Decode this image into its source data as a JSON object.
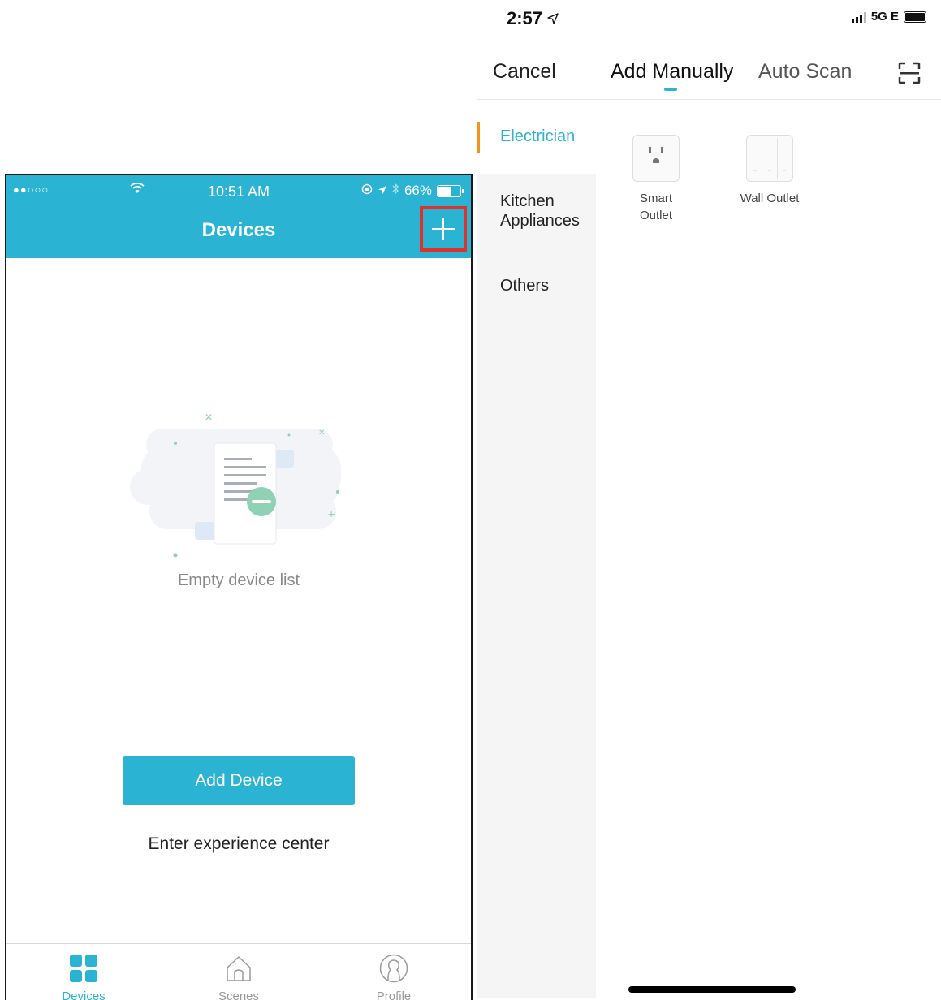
{
  "left_phone": {
    "status": {
      "signal": "●●○○○",
      "time": "10:51 AM",
      "battery_pct": "66%",
      "battery_level": 0.66
    },
    "header": {
      "title": "Devices"
    },
    "empty": {
      "message": "Empty device list"
    },
    "add_device_label": "Add Device",
    "experience_label": "Enter experience center",
    "tabs": [
      {
        "label": "Devices",
        "icon": "grid-icon",
        "active": true
      },
      {
        "label": "Scenes",
        "icon": "home-icon",
        "active": false
      },
      {
        "label": "Profile",
        "icon": "profile-icon",
        "active": false
      }
    ],
    "colors": {
      "accent": "#2bb3d4",
      "highlight_box": "#e0312a"
    }
  },
  "right_phone": {
    "status": {
      "time": "2:57",
      "network": "5G E"
    },
    "nav": {
      "cancel": "Cancel",
      "tab_manual": "Add Manually",
      "tab_scan": "Auto Scan"
    },
    "categories": [
      {
        "label": "Electrician",
        "active": true
      },
      {
        "label": "Kitchen Appliances",
        "active": false
      },
      {
        "label": "Others",
        "active": false
      }
    ],
    "devices": [
      {
        "label": "Smart Outlet",
        "icon": "smart-outlet-icon"
      },
      {
        "label": "Wall Outlet",
        "icon": "wall-outlet-icon"
      }
    ],
    "colors": {
      "accent": "#2bb3d4",
      "category_indicator": "#f29220"
    }
  }
}
